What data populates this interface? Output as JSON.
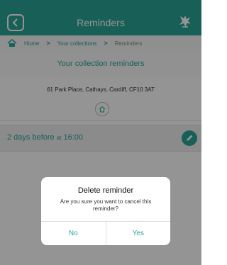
{
  "header": {
    "title": "Reminders",
    "back_icon": "chevron-left-icon",
    "logo_icon": "dragon-logo-icon"
  },
  "breadcrumb": {
    "home": "Home",
    "collections": "Your collections",
    "current": "Reminders"
  },
  "section": {
    "title": "Your collection reminders"
  },
  "address": "61 Park Place, Cathays, Cardiff, CF10 3AT",
  "reminder": {
    "days": "2 days before",
    "at": "at",
    "time": "16:00"
  },
  "dialog": {
    "title": "Delete reminder",
    "message": "Are you sure you want to cancel this reminder?",
    "no_label": "No",
    "yes_label": "Yes"
  },
  "colors": {
    "accent": "#2aa596",
    "overlay": "rgba(0,0,0,0.42)"
  }
}
